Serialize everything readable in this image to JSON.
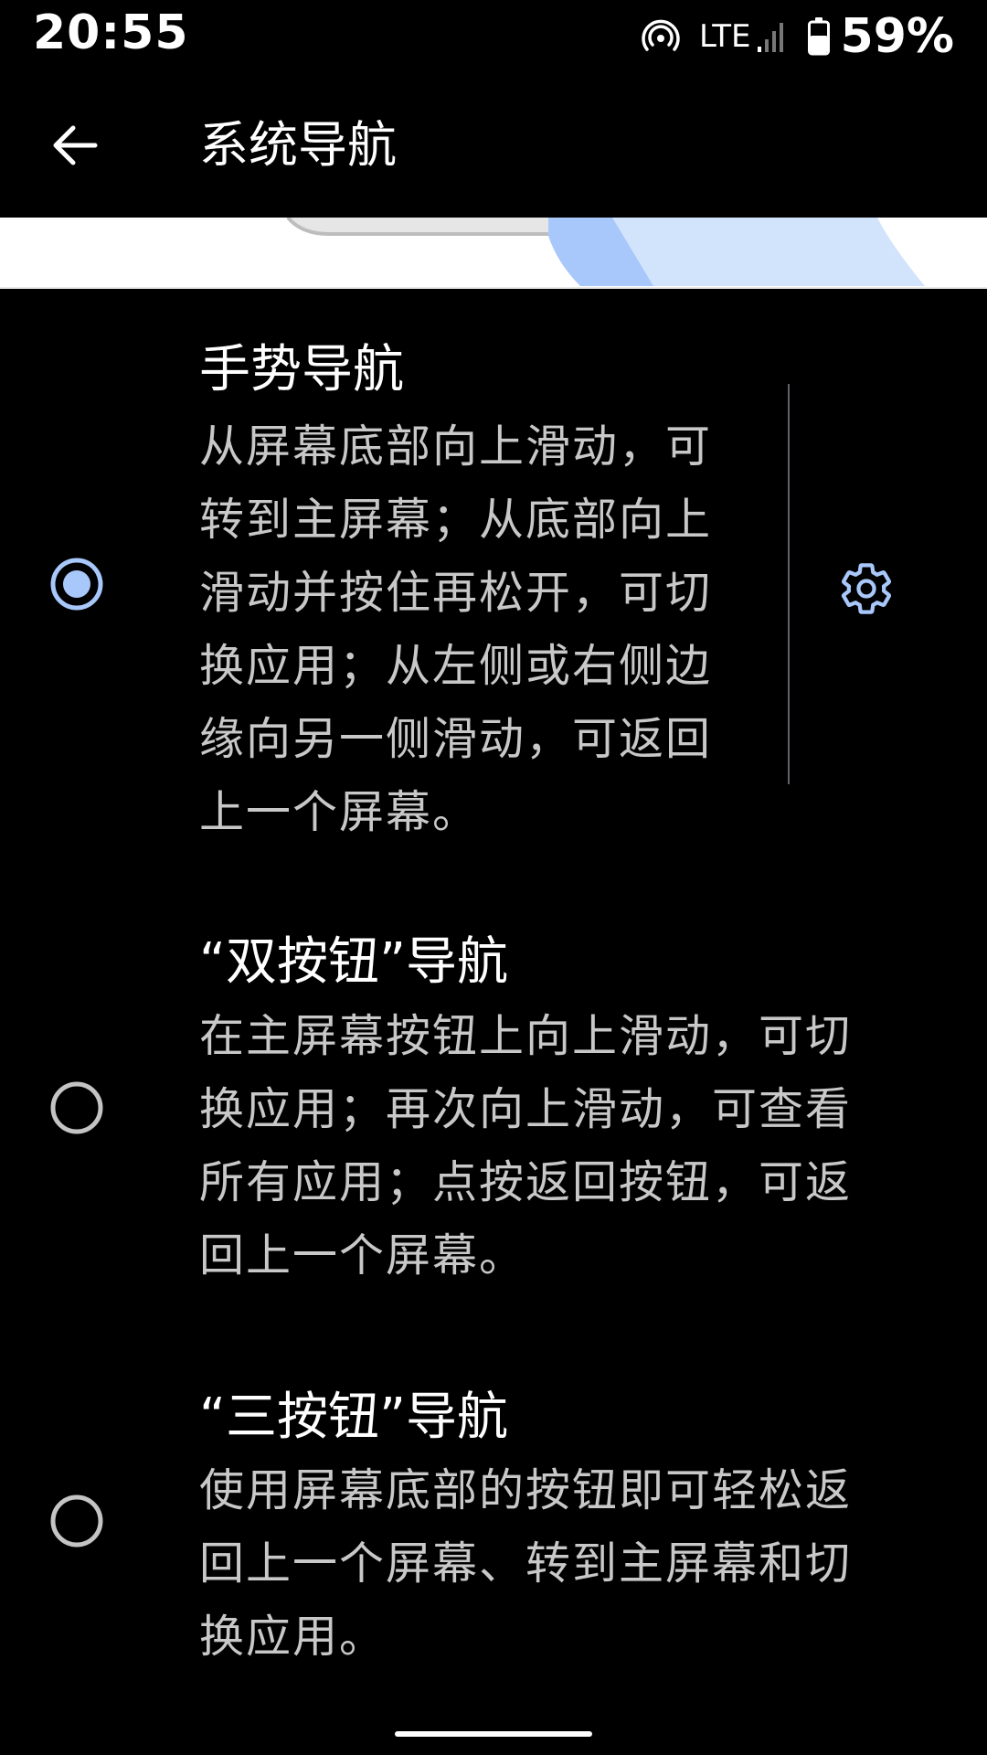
{
  "status_bar": {
    "time": "20:55",
    "network": "LTE",
    "battery_percent": "59%",
    "icons": [
      "hotspot-icon",
      "signal-icon",
      "battery-icon"
    ]
  },
  "app_bar": {
    "title": "系统导航",
    "back_icon": "arrow-back-icon"
  },
  "colors": {
    "accent": "#a8c7fa",
    "background": "#000000",
    "summary_text": "#c8c8c8",
    "radio_unselected": "#c4c4c4",
    "divider": "#5f6368"
  },
  "options": [
    {
      "title": "手势导航",
      "summary_lines": [
        "从屏幕底部向上滑动，可",
        "转到主屏幕；从底部向上",
        "滑动并按住再松开，可切",
        "换应用；从左侧或右侧边",
        "缘向另一侧滑动，可返回",
        "上一个屏幕。"
      ],
      "selected": true,
      "has_settings": true,
      "settings_icon": "gear-icon"
    },
    {
      "title": "“双按钮”导航",
      "summary_lines": [
        "在主屏幕按钮上向上滑动，可切",
        "换应用；再次向上滑动，可查看",
        "所有应用；点按返回按钮，可返",
        "回上一个屏幕。"
      ],
      "selected": false
    },
    {
      "title": "“三按钮”导航",
      "summary_lines": [
        "使用屏幕底部的按钮即可轻松返",
        "回上一个屏幕、转到主屏幕和切",
        "换应用。"
      ],
      "selected": false
    }
  ]
}
